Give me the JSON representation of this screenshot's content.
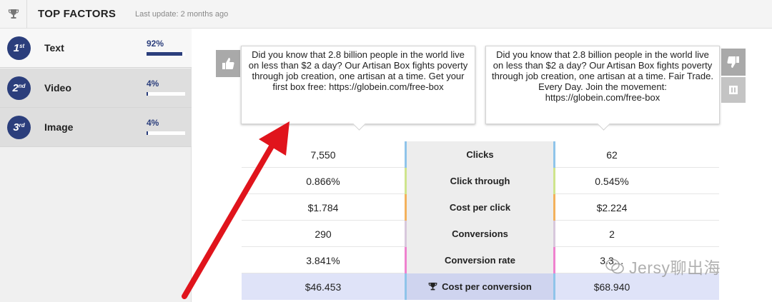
{
  "header": {
    "title": "TOP FACTORS",
    "last_update": "Last update: 2 months ago",
    "icon": "trophy-icon"
  },
  "factors": [
    {
      "rank": "1",
      "suffix": "st",
      "label": "Text",
      "pct": "92%",
      "value": 0.92
    },
    {
      "rank": "2",
      "suffix": "nd",
      "label": "Video",
      "pct": "4%",
      "value": 0.04
    },
    {
      "rank": "3",
      "suffix": "rd",
      "label": "Image",
      "pct": "4%",
      "value": 0.04
    }
  ],
  "ads": {
    "a": {
      "text": "Did you know that 2.8 billion people in the world live on less than $2 a day? Our Artisan Box fights poverty through job creation, one artisan at a time. Get your first box free: https://globein.com/free-box"
    },
    "b": {
      "text": "Did you know that 2.8 billion people in the world live on less than $2 a day? Our Artisan Box fights poverty through job creation, one artisan at a time. Fair Trade. Every Day. Join the movement: https://globein.com/free-box"
    }
  },
  "stats": [
    {
      "metric": "Clicks",
      "a": "7,550",
      "b": "62",
      "color": "#8fc4ea"
    },
    {
      "metric": "Click through",
      "a": "0.866%",
      "b": "0.545%",
      "color": "#cfe58c"
    },
    {
      "metric": "Cost per click",
      "a": "$1.784",
      "b": "$2.224",
      "color": "#f3b15c"
    },
    {
      "metric": "Conversions",
      "a": "290",
      "b": "2",
      "color": "#d8c8dc"
    },
    {
      "metric": "Conversion rate",
      "a": "3.841%",
      "b": "3.3…",
      "color": "#ef82cf"
    },
    {
      "metric": "Cost per conversion",
      "a": "$46.453",
      "b": "$68.940",
      "color": "#8fc4ea"
    }
  ],
  "watermark": "Jersy聊出海",
  "colors": {
    "accent": "#2b3e7c",
    "arrow": "#e0141c"
  }
}
